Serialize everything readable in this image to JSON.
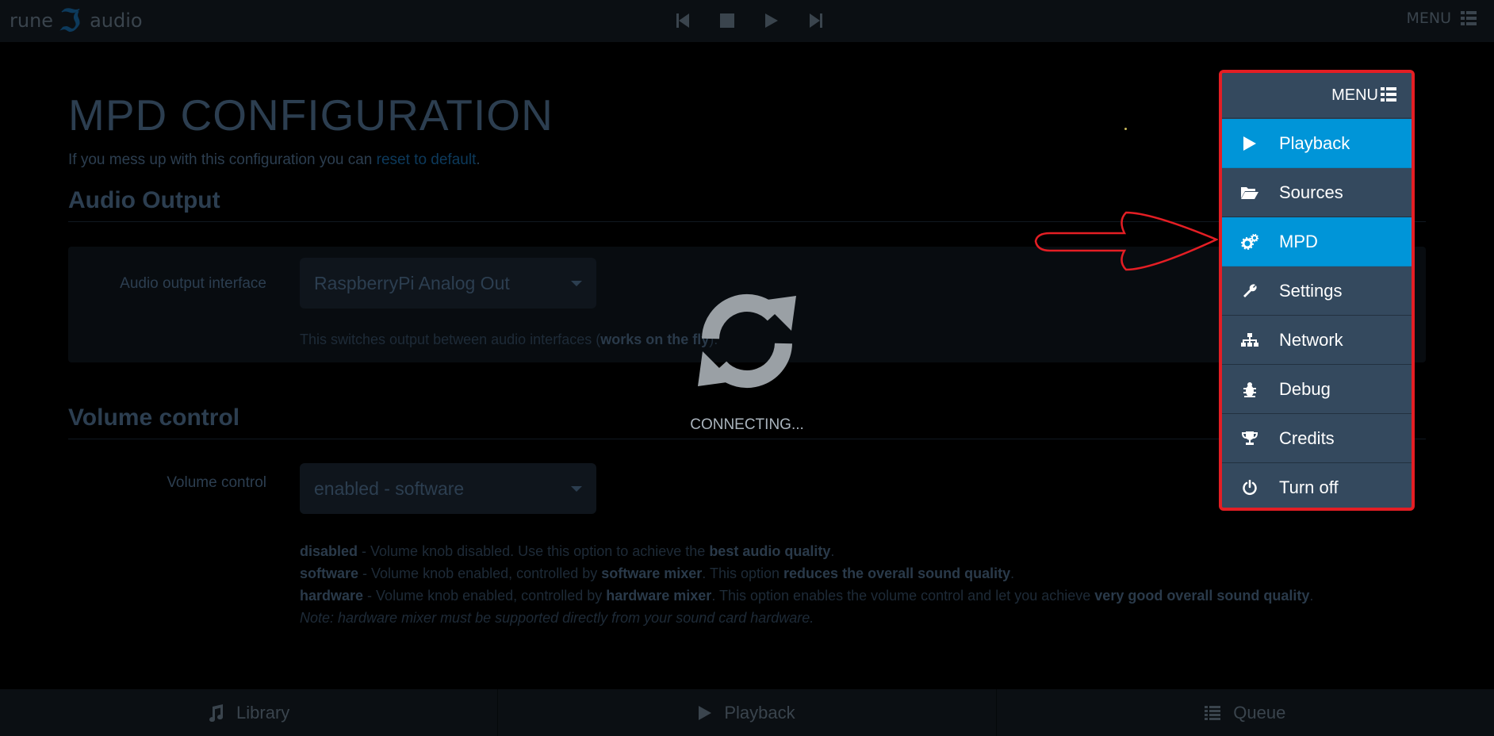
{
  "topbar": {
    "logo_left": "rune",
    "logo_mark": "ℑ",
    "logo_right": "audio",
    "menu_label": "MENU"
  },
  "main": {
    "title": "MPD CONFIGURATION",
    "intro_text": "If you mess up with this configuration you can ",
    "intro_link": "reset to default",
    "intro_end": ".",
    "audio_output": {
      "section_title": "Audio Output",
      "label": "Audio output interface",
      "selected": "RaspberryPi Analog Out",
      "help_prefix": "This switches output between audio interfaces (",
      "help_bold": "works on the fly",
      "help_suffix": ")."
    },
    "volume": {
      "section_title": "Volume control",
      "label": "Volume control",
      "selected": "enabled - software",
      "lines": [
        {
          "bold": "disabled",
          "text": " - Volume knob disabled. Use this option to achieve the ",
          "bold2": "best audio quality",
          "tail": "."
        },
        {
          "bold": "software",
          "text": " - Volume knob enabled, controlled by ",
          "bold2": "software mixer",
          "mid": ". This option ",
          "bold3": "reduces the overall sound quality",
          "tail": "."
        },
        {
          "bold": "hardware",
          "text": " - Volume knob enabled, controlled by ",
          "bold2": "hardware mixer",
          "mid": ". This option enables the volume control and let you achieve ",
          "bold3": "very good overall sound quality",
          "tail": "."
        }
      ],
      "note": "Note: hardware mixer must be supported directly from your sound card hardware."
    }
  },
  "overlay": {
    "status": "CONNECTING..."
  },
  "bottombar": {
    "library": "Library",
    "playback": "Playback",
    "queue": "Queue"
  },
  "menu": {
    "header": "MENU",
    "items": [
      {
        "label": "Playback",
        "icon": "play-icon",
        "active": true
      },
      {
        "label": "Sources",
        "icon": "folder-open-icon",
        "active": false
      },
      {
        "label": "MPD",
        "icon": "cogs-icon",
        "active": true
      },
      {
        "label": "Settings",
        "icon": "wrench-icon",
        "active": false
      },
      {
        "label": "Network",
        "icon": "sitemap-icon",
        "active": false
      },
      {
        "label": "Debug",
        "icon": "bug-icon",
        "active": false
      },
      {
        "label": "Credits",
        "icon": "trophy-icon",
        "active": false
      },
      {
        "label": "Turn off",
        "icon": "power-icon",
        "active": false
      }
    ]
  },
  "colors": {
    "accent": "#0095d8",
    "menu_bg": "#34495e",
    "highlight_border": "#e41e24"
  }
}
